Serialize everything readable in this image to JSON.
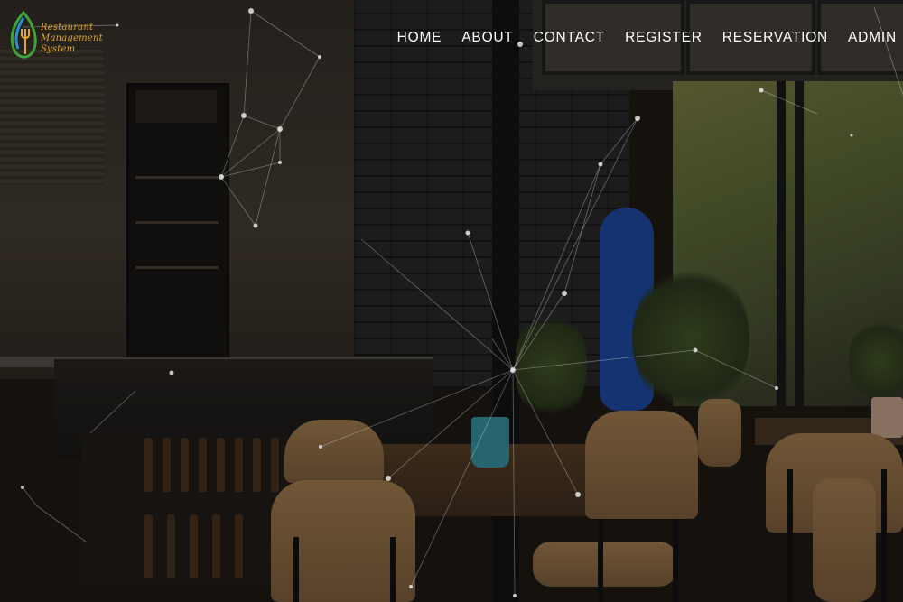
{
  "logo": {
    "line1": "Restaurant",
    "line2": "Management",
    "line3": "System",
    "icon": "leaf-spoon-fork-icon",
    "colors": {
      "leaf_green": "#3fa33b",
      "leaf_blue": "#2a8fd1",
      "text": "#e3a52a"
    }
  },
  "nav": {
    "items": [
      {
        "label": "HOME"
      },
      {
        "label": "ABOUT"
      },
      {
        "label": "CONTACT"
      },
      {
        "label": "REGISTER"
      },
      {
        "label": "RESERVATION"
      },
      {
        "label": "ADMIN"
      }
    ]
  },
  "hero": {
    "background": "cafe-interior-photo",
    "overlay": "network-particles"
  }
}
